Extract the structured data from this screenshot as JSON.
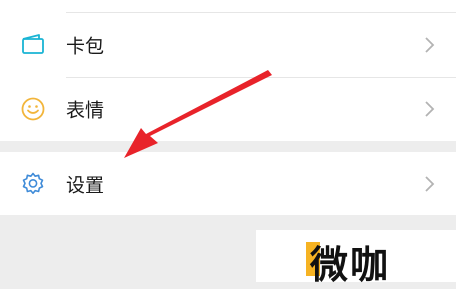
{
  "menu": {
    "items": [
      {
        "label": "卡包",
        "icon": "card-pack-icon",
        "color": "#19b4d4"
      },
      {
        "label": "表情",
        "icon": "sticker-smile-icon",
        "color": "#f2b53b"
      },
      {
        "label": "设置",
        "icon": "gear-icon",
        "color": "#3f8bd8"
      }
    ],
    "chevron_icon": "chevron-right-icon"
  },
  "annotation": {
    "arrow_color": "#e8232a"
  },
  "watermark": {
    "text": "微咖",
    "accent_color": "#f6b323"
  }
}
